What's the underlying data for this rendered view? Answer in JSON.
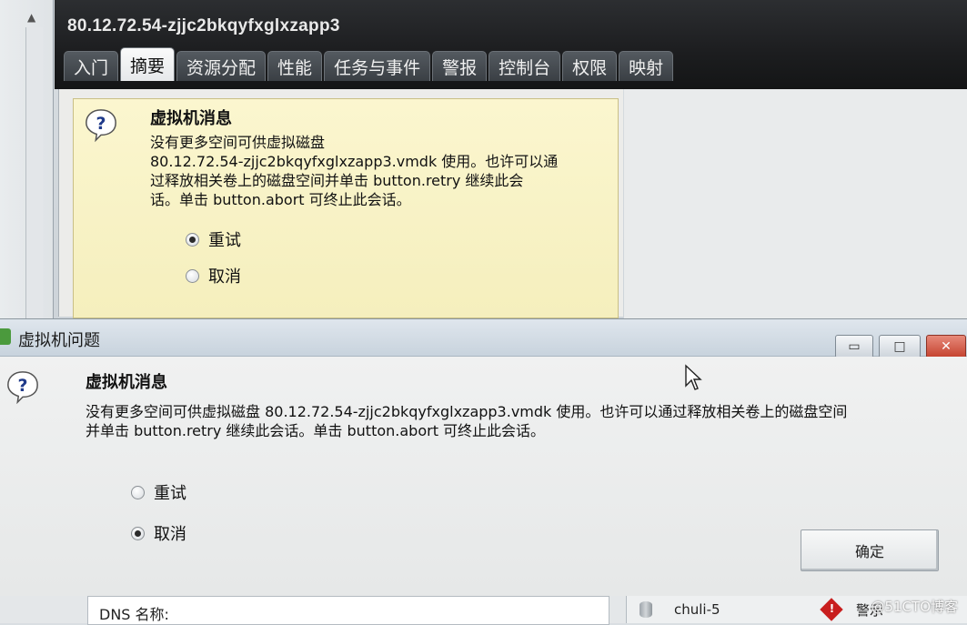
{
  "vm": {
    "title": "80.12.72.54-zjjc2bkqyfxglxzapp3",
    "tabs": [
      {
        "label": "入门"
      },
      {
        "label": "摘要"
      },
      {
        "label": "资源分配"
      },
      {
        "label": "性能"
      },
      {
        "label": "任务与事件"
      },
      {
        "label": "警报"
      },
      {
        "label": "控制台"
      },
      {
        "label": "权限"
      },
      {
        "label": "映射"
      }
    ],
    "active_tab": "摘要"
  },
  "summary_message": {
    "title": "虚拟机消息",
    "body_lines": [
      "没有更多空间可供虚拟磁盘",
      "80.12.72.54-zjjc2bkqyfxglxzapp3.vmdk 使用。也许可以通",
      "过释放相关卷上的磁盘空间并单击 button.retry 继续此会",
      "话。单击 button.abort 可终止此会话。"
    ],
    "options": [
      {
        "label": "重试",
        "selected": true
      },
      {
        "label": "取消",
        "selected": false
      }
    ]
  },
  "dialog": {
    "title": "虚拟机问题",
    "message_title": "虚拟机消息",
    "body_lines": [
      "没有更多空间可供虚拟磁盘 80.12.72.54-zjjc2bkqyfxglxzapp3.vmdk 使用。也许可以通过释放相关卷上的磁盘空间",
      "并单击 button.retry 继续此会话。单击 button.abort 可终止此会话。"
    ],
    "options": [
      {
        "label": "重试",
        "selected": false
      },
      {
        "label": "取消",
        "selected": true
      }
    ],
    "ok_label": "确定",
    "window_buttons": {
      "minimize": "▭",
      "maximize": "□",
      "close": "✕"
    }
  },
  "bottom": {
    "dns_label": "DNS 名称:",
    "host_name": "chuli-5",
    "alarm_label": "警示",
    "watermark": "@51CTO博客"
  },
  "icons": {
    "question": "question-icon",
    "database": "database-icon",
    "warning": "warning-icon"
  },
  "colors": {
    "header_dark": "#1c1d1f",
    "message_bg": "#f5efbd",
    "close_red": "#c4412e",
    "warning_red": "#c81e1e"
  }
}
